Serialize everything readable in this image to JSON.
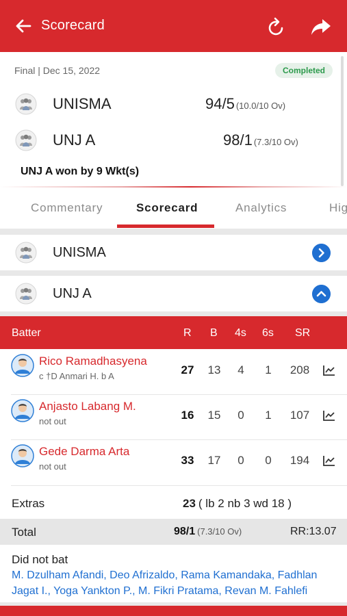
{
  "header": {
    "title": "Scorecard",
    "back_icon": "arrow-left-icon",
    "refresh_icon": "refresh-icon",
    "share_icon": "share-icon",
    "accent_color": "#d7292d"
  },
  "match": {
    "status_line": "Final | Dec 15, 2022",
    "badge": "Completed",
    "teams": [
      {
        "name": "UNISMA",
        "score": "94/5",
        "overs": "(10.0/10 Ov)"
      },
      {
        "name": "UNJ A",
        "score": "98/1",
        "overs": "(7.3/10 Ov)"
      }
    ],
    "result": "UNJ A won by 9 Wkt(s)"
  },
  "tabs": [
    "Commentary",
    "Scorecard",
    "Analytics",
    "Hig"
  ],
  "active_tab": "Scorecard",
  "innings": [
    {
      "team": "UNISMA",
      "state": "collapsed",
      "icon": "chevron-right-icon"
    },
    {
      "team": "UNJ A",
      "state": "expanded",
      "icon": "chevron-up-icon"
    }
  ],
  "table": {
    "headers": {
      "batter": "Batter",
      "r": "R",
      "b": "B",
      "fours": "4s",
      "sixes": "6s",
      "sr": "SR"
    },
    "batters": [
      {
        "name": "Rico Ramadhasyena",
        "dismissal": "c †D Anmari H. b A",
        "r": "27",
        "b": "13",
        "fours": "4",
        "sixes": "1",
        "sr": "208"
      },
      {
        "name": "Anjasto Labang M.",
        "dismissal": "not out",
        "r": "16",
        "b": "15",
        "fours": "0",
        "sixes": "1",
        "sr": "107"
      },
      {
        "name": "Gede Darma Arta",
        "dismissal": "not out",
        "r": "33",
        "b": "17",
        "fours": "0",
        "sixes": "0",
        "sr": "194"
      }
    ],
    "extras_label": "Extras",
    "extras_total": "23",
    "extras_detail": "( lb 2 nb 3 wd 18 )",
    "total_label": "Total",
    "total_score": "98/1",
    "total_overs": "(7.3/10 Ov)",
    "run_rate": "RR:13.07",
    "dnb_label": "Did not bat",
    "dnb_players": "M. Dzulham Afandi, Deo Afrizaldo, Rama Kamandaka, Fadhlan Jagat I., Yoga Yankton P., M. Fikri Pratama, Revan M. Fahlefi"
  }
}
